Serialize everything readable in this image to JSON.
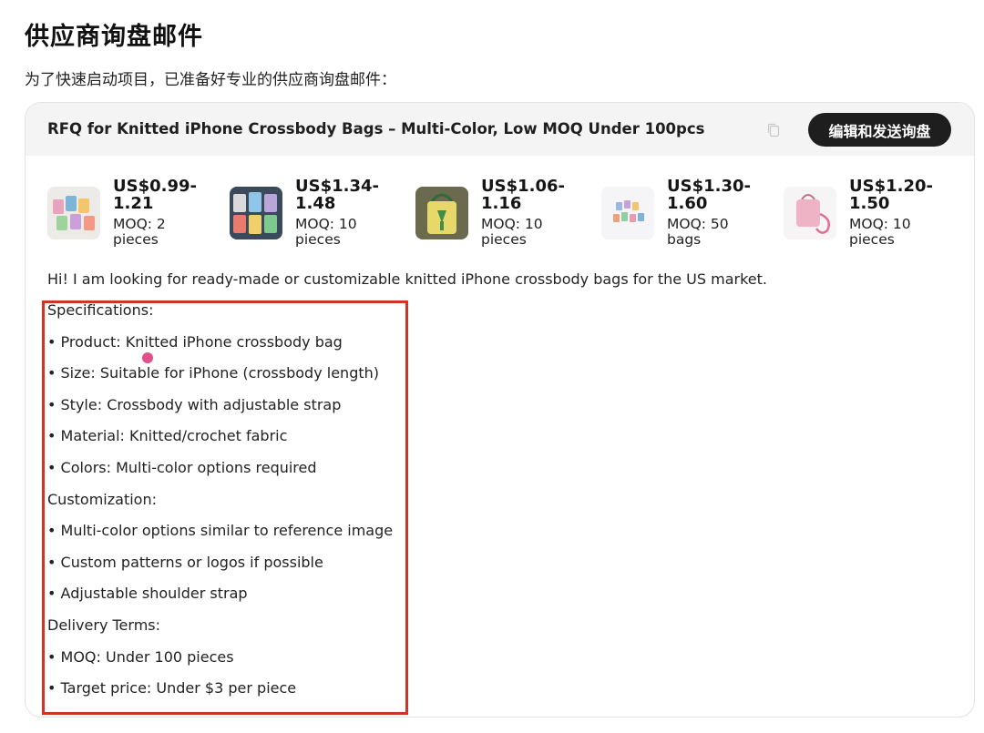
{
  "page": {
    "title": "供应商询盘邮件",
    "subtitle": "为了快速启动项目，已准备好专业的供应商询盘邮件："
  },
  "email": {
    "subject": "RFQ for Knitted iPhone Crossbody Bags – Multi-Color, Low MOQ Under 100pcs",
    "edit_send_label": "编辑和发送询盘",
    "copy_icon": "copy-icon",
    "products": [
      {
        "price": "US$0.99-1.21",
        "moq": "MOQ: 2 pieces",
        "thumb_color": "#c9a8b8"
      },
      {
        "price": "US$1.34-1.48",
        "moq": "MOQ: 10 pieces",
        "thumb_color": "#8fa4b8"
      },
      {
        "price": "US$1.06-1.16",
        "moq": "MOQ: 10 pieces",
        "thumb_color": "#d9d27a"
      },
      {
        "price": "US$1.30-1.60",
        "moq": "MOQ: 50 bags",
        "thumb_color": "#e8e4f0"
      },
      {
        "price": "US$1.20-1.50",
        "moq": "MOQ: 10 pieces",
        "thumb_color": "#f0c8d4"
      }
    ],
    "intro": "Hi! I am looking for ready-made or customizable knitted iPhone crossbody bags for the US market.",
    "lines": [
      "Specifications:",
      "• Product: Knitted iPhone crossbody bag",
      "• Size: Suitable for iPhone (crossbody length)",
      "• Style: Crossbody with adjustable strap",
      "• Material: Knitted/crochet fabric",
      "• Colors: Multi-color options required",
      "Customization:",
      "• Multi-color options similar to reference image",
      "• Custom patterns or logos if possible",
      "• Adjustable shoulder strap",
      "Delivery Terms:",
      "• MOQ: Under 100 pieces",
      "• Target price: Under $3 per piece"
    ]
  },
  "colors": {
    "highlight": "#cf3428",
    "cursor": "#e0508a",
    "button_bg": "#1e1e1e",
    "header_bg": "#f4f4f4"
  }
}
